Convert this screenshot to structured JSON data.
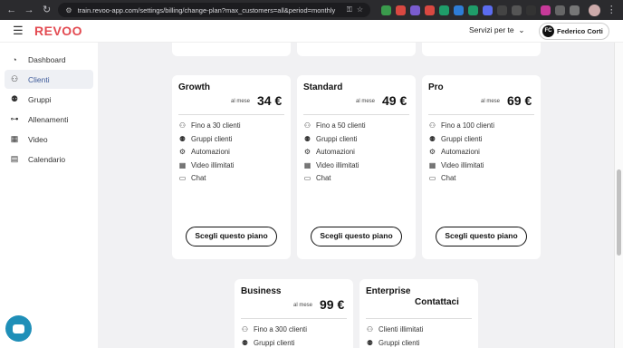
{
  "browser": {
    "url": "train.revoo-app.com/settings/billing/change-plan?max_customers=all&period=monthly"
  },
  "header": {
    "logo": "REVOO",
    "services_menu": "Servizi per te",
    "user_initials": "FC",
    "user_name": "Federico Corti"
  },
  "sidebar": {
    "items": [
      {
        "label": "Dashboard",
        "icon": "gauge-icon"
      },
      {
        "label": "Clienti",
        "icon": "user-icon",
        "active": true
      },
      {
        "label": "Gruppi",
        "icon": "group-icon"
      },
      {
        "label": "Allenamenti",
        "icon": "dumbbell-icon"
      },
      {
        "label": "Video",
        "icon": "film-icon"
      },
      {
        "label": "Calendario",
        "icon": "calendar-icon"
      }
    ]
  },
  "plans": [
    {
      "name": "Growth",
      "per": "al mese",
      "price": "34 €",
      "features": [
        "Fino a 30 clienti",
        "Gruppi clienti",
        "Automazioni",
        "Video illimitati",
        "Chat"
      ],
      "button": "Scegli questo piano"
    },
    {
      "name": "Standard",
      "per": "al mese",
      "price": "49 €",
      "features": [
        "Fino a 50 clienti",
        "Gruppi clienti",
        "Automazioni",
        "Video illimitati",
        "Chat"
      ],
      "button": "Scegli questo piano"
    },
    {
      "name": "Pro",
      "per": "al mese",
      "price": "69 €",
      "features": [
        "Fino a 100 clienti",
        "Gruppi clienti",
        "Automazioni",
        "Video illimitati",
        "Chat"
      ],
      "button": "Scegli questo piano"
    },
    {
      "name": "Business",
      "per": "al mese",
      "price": "99 €",
      "features": [
        "Fino a 300 clienti",
        "Gruppi clienti"
      ]
    },
    {
      "name": "Enterprise",
      "contact": "Contattaci",
      "features": [
        "Clienti illimitati",
        "Gruppi clienti"
      ]
    }
  ],
  "colors": {
    "brand": "#e34b52",
    "chat_button": "#1f8fb8",
    "active_nav": "#3d5a99"
  }
}
